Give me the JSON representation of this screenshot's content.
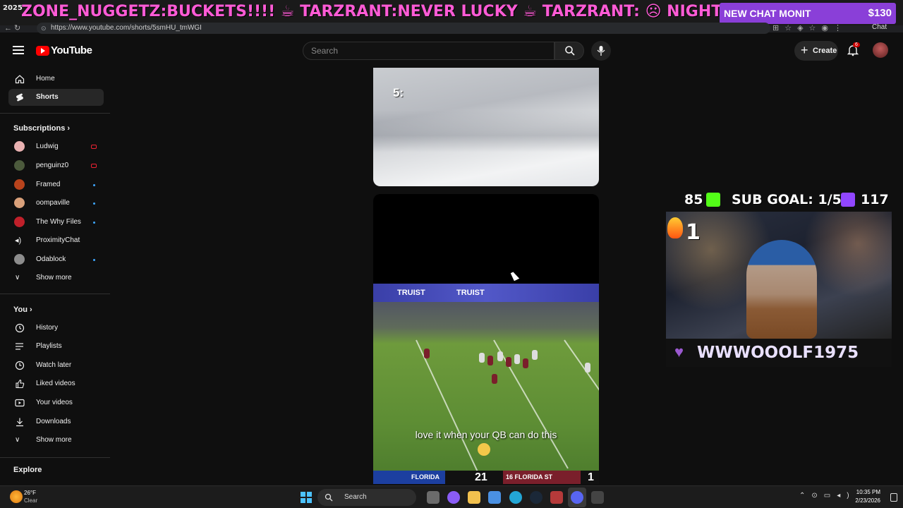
{
  "stream_overlay": {
    "ticker_year": "2025",
    "ticker_text": "ZONE_NUGGETZ:BUCKETS!!!! ☕ TARZRANT:NEVER LUCKY ☕ TARZRANT: ☹ NIGHTBO",
    "chat_monitor_label": "NEW CHAT MONIT",
    "chat_monitor_amount_a": "$130",
    "chat_monitor_amount_b": "$130",
    "kick_count": "85",
    "sub_goal": "SUB GOAL: 1/5",
    "twitch_count": "117",
    "fire_count": "1",
    "latest_follower": "WWWOOOLF1975",
    "icons": [
      "kick-icon",
      "twitch-icon",
      "fire-icon",
      "heart-icon"
    ],
    "colors": {
      "kick": "#53fc18",
      "twitch": "#9146ff",
      "heart": "#9b59d0",
      "monitor": "#8a3fd8"
    }
  },
  "browser": {
    "url": "https://www.youtube.com/shorts/5smHU_tmWGI",
    "chat_button": "Chat"
  },
  "youtube": {
    "logo": "YouTube",
    "search_placeholder": "Search",
    "create_label": "Create",
    "notifications_count": "6",
    "colors": {
      "brand": "#ff0000",
      "background": "#0f0f0f"
    }
  },
  "sidebar": {
    "main": [
      {
        "label": "Home",
        "icon": "home-icon"
      },
      {
        "label": "Shorts",
        "icon": "shorts-icon",
        "active": true
      }
    ],
    "subscriptions_title": "Subscriptions",
    "subscriptions": [
      {
        "label": "Ludwig",
        "status": "live"
      },
      {
        "label": "penguinz0",
        "status": "live"
      },
      {
        "label": "Framed",
        "status": "new"
      },
      {
        "label": "oompaville",
        "status": "new"
      },
      {
        "label": "The Why Files",
        "status": "new"
      },
      {
        "label": "ProximityChat",
        "status": ""
      },
      {
        "label": "Odablock",
        "status": "new"
      }
    ],
    "show_more_1": "Show more",
    "you_title": "You",
    "you_items": [
      {
        "label": "History",
        "icon": "history-icon"
      },
      {
        "label": "Playlists",
        "icon": "playlists-icon"
      },
      {
        "label": "Watch later",
        "icon": "clock-icon"
      },
      {
        "label": "Liked videos",
        "icon": "thumbs-up-icon"
      },
      {
        "label": "Your videos",
        "icon": "video-icon"
      },
      {
        "label": "Downloads",
        "icon": "download-icon"
      }
    ],
    "show_more_2": "Show more",
    "explore_title": "Explore"
  },
  "shorts": {
    "short_a_label": "5:",
    "short_b_banner_1": "TRUIST",
    "short_b_banner_2": "TRUIST",
    "caption": "love it when your QB can do this",
    "score_left_team": "FLORIDA",
    "score_left_points": "21",
    "score_right_team": "16 FLORIDA ST",
    "score_right_points": "1"
  },
  "taskbar": {
    "temperature": "26°F",
    "condition": "Clear",
    "search_label": "Search",
    "time": "10:35 PM",
    "date": "2/23/2026"
  }
}
